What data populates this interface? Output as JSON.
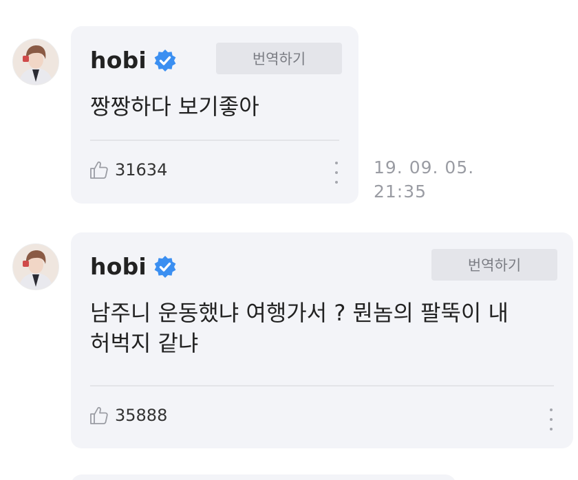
{
  "comments": [
    {
      "author": "hobi",
      "verified": true,
      "translate_label": "번역하기",
      "text": "짱짱하다 보기좋아",
      "likes": "31634",
      "timestamp": "19. 09. 05. 21:35"
    },
    {
      "author": "hobi",
      "verified": true,
      "translate_label": "번역하기",
      "text": "남주니 운동했냐 여행가서 ? 뭔놈의 팔뚝이 내 허벅지 같냐",
      "likes": "35888"
    }
  ],
  "icons": {
    "avatar": "profile-photo",
    "verified": "verified-check-badge",
    "like": "thumbs-up-outline-icon",
    "more": "vertical-ellipsis-icon"
  },
  "colors": {
    "card_background": "#f3f4f8",
    "translate_button": "#e4e5ea",
    "verified_badge": "#3b8ff1",
    "text": "#222222",
    "meta_text": "#9a9ca3"
  }
}
